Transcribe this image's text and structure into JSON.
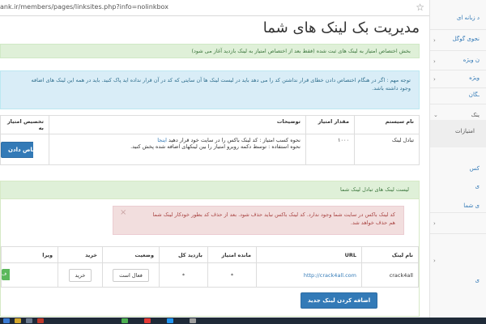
{
  "browser": {
    "url": "ank.ir/members/pages/linksites.php?info=nolinkbox"
  },
  "page": {
    "title": "مدیریت بک لینک های شما"
  },
  "alerts": {
    "success": "بخش اختصاص امتیاز به لینک های ثبت شده (فقط بعد از اختصاص امتیاز به لینک بازدید آغاز می شود)",
    "info_line1": "توجه مهم : اگر در هنگام اختصاص دادن خطای قرار نداشتن کد را می دهد باید در لیست لینک ها آن سایتی که کد در آن قرار نداده اید پاک کنید. باید در همه این لینک های اضافه",
    "info_line2": "وجود داشته باشد."
  },
  "system_table": {
    "headers": {
      "name": "نام سیستم",
      "points": "مقدار امتیاز",
      "description": "توضیحات",
      "assign": "تخصیص امتیاز به"
    },
    "row": {
      "name": "تبادل لینک",
      "points": "۱۰۰۰",
      "desc_line1": "نحوه کسب امتیاز : کد لینک باکس را در سایت خود قرار دهید",
      "desc_link": "اینجا",
      "desc_line2": "نحوه استفاده : توسط دکمه روبرو امتیاز را بین لینکهای اضافه شده پخش کنید.",
      "assign_button": "اختصاص دادن"
    }
  },
  "links_panel": {
    "heading": "لیست لینک های تبادل لینک شما",
    "danger_line1": "کد لینک باکس در سایت شما وجود ندارد. کد لینک باکس نباید حذف شود. بعد از حذف کد بطور خودکار لینک شما",
    "danger_line2": "هم حذف خواهد شد.",
    "close_symbol": "×",
    "headers": {
      "name": "نام لینک",
      "url": "URL",
      "remaining": "مانده امتیاز",
      "total_visits": "بازدید کل",
      "status": "وضعیت",
      "buy": "خرید",
      "edit": "ویرا"
    },
    "row": {
      "name": "crack4all",
      "url": "http://crack4all.com",
      "remaining": "*",
      "total_visits": "*",
      "status_button": "فعال است",
      "buy_button": "خرید",
      "edit_button": "ف"
    },
    "add_button": "اضافه کردن لینک جدید"
  },
  "sidebar": {
    "items": [
      {
        "label": "د زبانه ای",
        "arrow": ""
      },
      {
        "label": "نجوی گوگل",
        "arrow": "›"
      },
      {
        "label": "ن ویژه",
        "arrow": "›"
      },
      {
        "label": "ویژه",
        "arrow": "›"
      },
      {
        "label": "ـگان",
        "arrow": ""
      },
      {
        "label": "ینک",
        "arrow": "⌄"
      },
      {
        "label": "امتیازات",
        "arrow": ""
      },
      {
        "label": "کس",
        "arrow": ""
      },
      {
        "label": "ی",
        "arrow": ""
      },
      {
        "label": "ی شما",
        "arrow": ""
      },
      {
        "label": "",
        "arrow": "›"
      },
      {
        "label": "",
        "arrow": "›"
      },
      {
        "label": "ی",
        "arrow": ""
      }
    ]
  }
}
